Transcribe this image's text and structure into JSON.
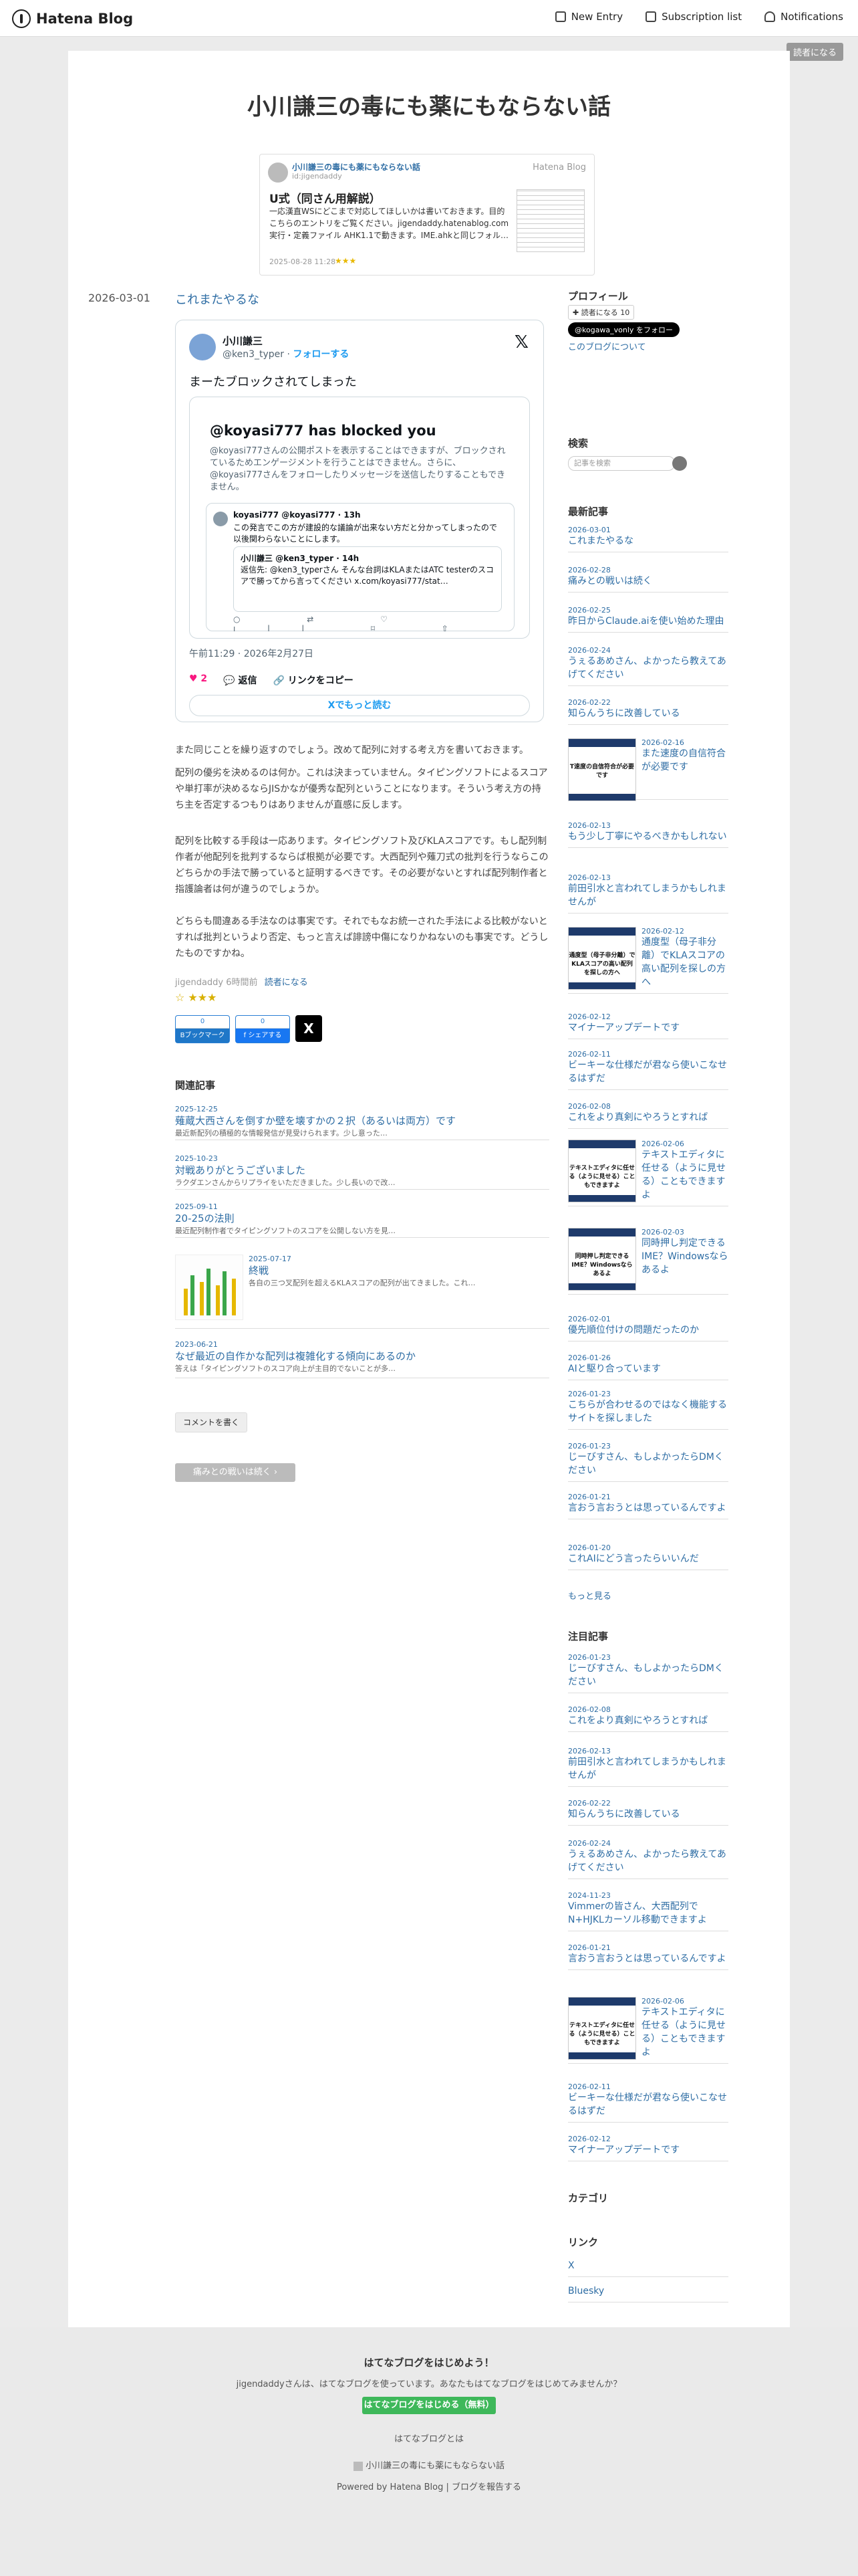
{
  "topbar": {
    "logo": "Hatena Blog",
    "new_entry": "New Entry",
    "subscription": "Subscription list",
    "notifications": "Notifications"
  },
  "reader_button": "読者になる",
  "blog_title": "小川謙三の毒にも薬にもならない話",
  "card": {
    "blog": "小川謙三の毒にも薬にもならない話",
    "id": "id:jigendaddy",
    "brand": "Hatena Blog",
    "heading": "U式（同さん用解説）",
    "body": "一応漢直WSにどこまで対応してほしいかは書いておきます。目的こちらのエントリをご覧ください。jigendaddy.hatenablog.com 実行・定義ファイル AHK1.1で動きます。IME.ahkと同じフォル…",
    "date": "2025-08-28 11:28",
    "stars": "★★★"
  },
  "post": {
    "date": "2026-03-01",
    "title": "これまたやるな"
  },
  "tweet": {
    "name": "小川謙三",
    "handle": "@ken3_typer",
    "follow": "フォローする",
    "text": "まーたブロックされてしまった",
    "blocked_head": "@koyasi777 has blocked you",
    "blocked_body": "@koyasi777さんの公開ポストを表示することはできますが、ブロックされているためエンゲージメントを行うことはできません。さらに、@koyasi777さんをフォローしたりメッセージを送信したりすることもできません。",
    "inner_name": "koyasi777 @koyasi777 · 13h",
    "inner_text": "この発言でこの方が建設的な議論が出来ない方だと分かってしまったので以後関わらないことにします。",
    "quote_name": "小川謙三 @ken3_typer · 14h",
    "quote_text": "返信先: @ken3_typerさん そんな台詞はKLAまたはATC testerのスコアで勝ってから言ってください x.com/koyasi777/stat…",
    "inner_icons": "○ ⇄ ♡ ıll ⌑ ⇧",
    "time": "午前11:29 · 2026年2月27日",
    "likes": "♥ 2",
    "reply": "返信",
    "copy": "リンクをコピー",
    "more": "Xでもっと読む"
  },
  "paragraphs": [
    "また同じことを繰り返すのでしょう。改めて配列に対する考え方を書いておきます。",
    "配列の優劣を決めるのは何か。これは決まっていません。タイピングソフトによるスコアや単打率が決めるならJISかなが優秀な配列ということになります。そういう考え方の持ち主を否定するつもりはありませんが直感に反します。",
    "配列を比較する手段は一応あります。タイピングソフト及びKLAスコアです。もし配列制作者が他配列を批判するならば根拠が必要です。大西配列や薙刀式の批判を行うならこのどちらかの手法で勝っていると証明するべきです。その必要がないとすれば配列制作者と指護論者は何が違うのでしょうか。",
    "どちらも間違ある手法なのは事実です。それでもなお統一された手法による比較がないとすれば批判というより否定、もっと言えば誹謗中傷になりかねないのも事実です。どうしたものですかね。"
  ],
  "meta": {
    "author": "jigendaddy",
    "ago": "6時間前",
    "reader": "読者になる"
  },
  "share": {
    "hatena_count": "0",
    "hatena_label": "Bブックマーク",
    "fb_count": "0",
    "fb_label": "f シェアする",
    "x_label": "X"
  },
  "related": {
    "heading": "関連記事",
    "items": [
      {
        "date": "2025-12-25",
        "title": "薙蔵大西さんを倒すか壁を壊すかの２択（あるいは両方）です",
        "excerpt": "最近新配列の積極的な情報発信が見受けられます。少し意った…"
      },
      {
        "date": "2025-10-23",
        "title": "対戦ありがとうございました",
        "excerpt": "ラクダエンさんからリプライをいただきました。少し長いので改…"
      },
      {
        "date": "2025-09-11",
        "title": "20-25の法則",
        "excerpt": "最近配列制作者でタイピングソフトのスコアを公開しない方を見…"
      },
      {
        "date": "2025-07-17",
        "title": "終戦",
        "excerpt": "各自の三つ叉配列を超えるKLAスコアの配列が出てきました。これ…"
      },
      {
        "date": "2023-06-21",
        "title": "なぜ最近の自作かな配列は複雑化する傾向にあるのか",
        "excerpt": "答えは「タイピングソフトのスコア向上が主目的でないことが多…"
      }
    ]
  },
  "comment_button": "コメントを書く",
  "prev_button": "痛みとの戦いは続く ›",
  "sidebar": {
    "profile_heading": "プロフィール",
    "reader_count": "読者になる 10",
    "x_follow": "@kogawa_vonly をフォロー",
    "about": "このブログについて",
    "search_heading": "検索",
    "search_placeholder": "記事を検索",
    "recent_heading": "最新記事",
    "recent": [
      {
        "date": "2026-03-01",
        "title": "これまたやるな"
      },
      {
        "date": "2026-02-28",
        "title": "痛みとの戦いは続く"
      },
      {
        "date": "2026-02-25",
        "title": "昨日からClaude.aiを使い始めた理由"
      },
      {
        "date": "2026-02-24",
        "title": "うぇるあめさん、よかったら教えてあげてください"
      },
      {
        "date": "2026-02-22",
        "title": "知らんうちに改善している"
      },
      {
        "date": "2026-02-16",
        "title": "また速度の自信符合が必要です",
        "img": "T速度の自信符合が必要です"
      },
      {
        "date": "2026-02-13",
        "title": "もう少し丁寧にやるべきかもしれない"
      },
      {
        "date": "2026-02-13",
        "title": "前田引水と言われてしまうかもしれませんが"
      },
      {
        "date": "2026-02-12",
        "title": "通度型（母子非分離）でKLAスコアの高い配列を探しの方へ",
        "img": "通度型（母子非分離）でKLAスコアの高い配列を探しの方へ"
      },
      {
        "date": "2026-02-12",
        "title": "マイナーアップデートです"
      },
      {
        "date": "2026-02-11",
        "title": "ビーキーな仕様だが君なら使いこなせるはずだ"
      },
      {
        "date": "2026-02-08",
        "title": "これをより真剣にやろうとすれば"
      },
      {
        "date": "2026-02-06",
        "title": "テキストエディタに任せる（ように見せる）こともできますよ",
        "img": "テキストエディタに任せる（ように見せる）こともできますよ"
      },
      {
        "date": "2026-02-03",
        "title": "同時押し判定できるIME？Windowsならあるよ",
        "img": "同時押し判定できるIME？Windowsならあるよ"
      },
      {
        "date": "2026-02-01",
        "title": "優先順位付けの問題だったのか"
      },
      {
        "date": "2026-01-26",
        "title": "AIと駆り合っています"
      },
      {
        "date": "2026-01-23",
        "title": "こちらが合わせるのではなく機能するサイトを探しました"
      },
      {
        "date": "2026-01-23",
        "title": "じーびすさん、もしよかったらDMください"
      },
      {
        "date": "2026-01-21",
        "title": "言おう言おうとは思っているんですよ"
      },
      {
        "date": "2026-01-20",
        "title": "これAIにどう言ったらいいんだ"
      }
    ],
    "more": "もっと見る",
    "popular_heading": "注目記事",
    "popular": [
      {
        "date": "2026-01-23",
        "title": "じーびすさん、もしよかったらDMください"
      },
      {
        "date": "2026-02-08",
        "title": "これをより真剣にやろうとすれば"
      },
      {
        "date": "2026-02-13",
        "title": "前田引水と言われてしまうかもしれませんが"
      },
      {
        "date": "2026-02-22",
        "title": "知らんうちに改善している"
      },
      {
        "date": "2026-02-24",
        "title": "うぇるあめさん、よかったら教えてあげてください"
      },
      {
        "date": "2024-11-23",
        "title": "Vimmerの皆さん、大西配列でN+HJKLカーソル移動できますよ"
      },
      {
        "date": "2026-01-21",
        "title": "言おう言おうとは思っているんですよ"
      },
      {
        "date": "2026-02-06",
        "title": "テキストエディタに任せる（ように見せる）こともできますよ",
        "img": "テキストエディタに任せる（ように見せる）こともできますよ"
      },
      {
        "date": "2026-02-11",
        "title": "ビーキーな仕様だが君なら使いこなせるはずだ"
      },
      {
        "date": "2026-02-12",
        "title": "マイナーアップデートです"
      }
    ],
    "category_heading": "カテゴリ",
    "link_heading": "リンク",
    "links": [
      "X",
      "Bluesky"
    ]
  },
  "footer": {
    "heading": "はてなブログをはじめよう！",
    "desc": "jigendaddyさんは、はてなブログを使っています。あなたもはてなブログをはじめてみませんか？",
    "cta": "はてなブログをはじめる（無料）",
    "about": "はてなブログとは",
    "blog": "小川謙三の毒にも薬にもならない話",
    "powered": "Powered by Hatena Blog | ブログを報告する"
  }
}
